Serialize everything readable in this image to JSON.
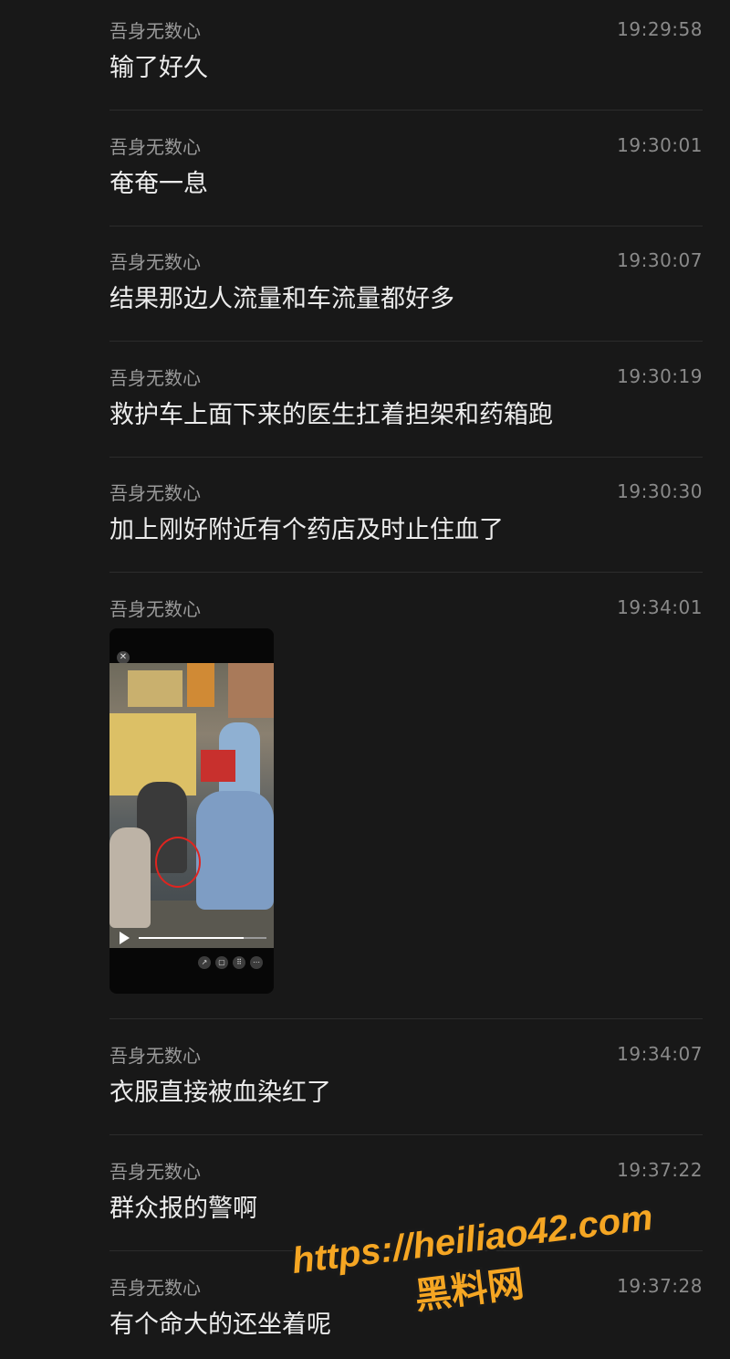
{
  "messages": [
    {
      "sender": "吾身无数心",
      "time": "19:29:58",
      "text": "输了好久"
    },
    {
      "sender": "吾身无数心",
      "time": "19:30:01",
      "text": "奄奄一息"
    },
    {
      "sender": "吾身无数心",
      "time": "19:30:07",
      "text": "结果那边人流量和车流量都好多"
    },
    {
      "sender": "吾身无数心",
      "time": "19:30:19",
      "text": "救护车上面下来的医生扛着担架和药箱跑"
    },
    {
      "sender": "吾身无数心",
      "time": "19:30:30",
      "text": "加上刚好附近有个药店及时止住血了"
    },
    {
      "sender": "吾身无数心",
      "time": "19:34:01",
      "text": ""
    },
    {
      "sender": "吾身无数心",
      "time": "19:34:07",
      "text": "衣服直接被血染红了"
    },
    {
      "sender": "吾身无数心",
      "time": "19:37:22",
      "text": "群众报的警啊"
    },
    {
      "sender": "吾身无数心",
      "time": "19:37:28",
      "text": "有个命大的还坐着呢"
    }
  ],
  "video": {
    "progress": 0.82,
    "close_icon": "close-icon",
    "play_icon": "play-icon",
    "control_icons": [
      "share-icon",
      "save-icon",
      "grid-icon",
      "more-icon"
    ]
  },
  "watermark": {
    "url": "https://heiliao42.com",
    "name": "黑料网",
    "color": "#f5a623"
  },
  "colors": {
    "background": "#181818",
    "sender": "#9a9a9a",
    "time": "#8a8a8a",
    "text": "#ececec",
    "divider": "#2c2c2c"
  }
}
